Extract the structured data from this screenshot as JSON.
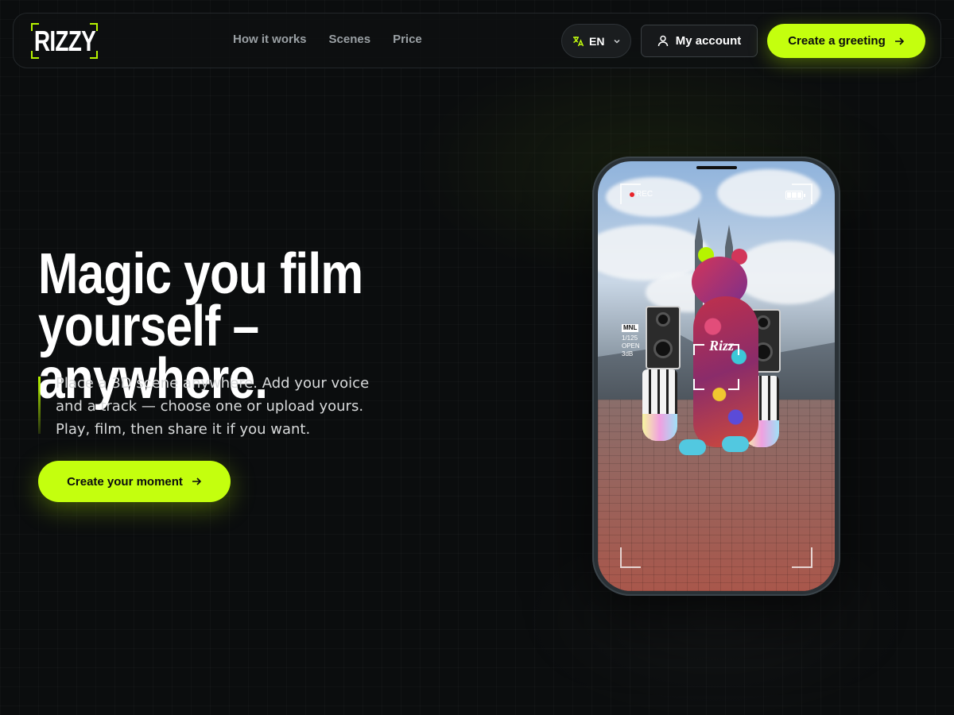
{
  "brand": {
    "logo_text": "RIZZY"
  },
  "nav": {
    "links": [
      {
        "label": "How it works"
      },
      {
        "label": "Scenes"
      },
      {
        "label": "Price"
      }
    ],
    "language": "EN",
    "account_label": "My account",
    "cta_label": "Create a greeting"
  },
  "hero": {
    "headline_line1": "Magic you film",
    "headline_line2": "yourself – anywhere.",
    "subtitle": "Place a 3D scene anywhere. Add your voice and a track — choose one or upload yours. Play, film, then share it if you want.",
    "cta_label": "Create your moment"
  },
  "phone": {
    "rec_label": "REC",
    "camera_mode": "MNL",
    "shutter": "1/125",
    "aperture": "OPEN",
    "gain": "3dB",
    "bear_logo_text": "Rizz"
  },
  "colors": {
    "accent": "#c4ff0e",
    "background": "#0b0d0e",
    "nav_text": "#9aa0a4",
    "rec_dot": "#e8232a"
  },
  "icons": {
    "language": "translate-icon",
    "chevron": "chevron-down-icon",
    "account": "user-icon",
    "arrow": "arrow-right-icon"
  }
}
